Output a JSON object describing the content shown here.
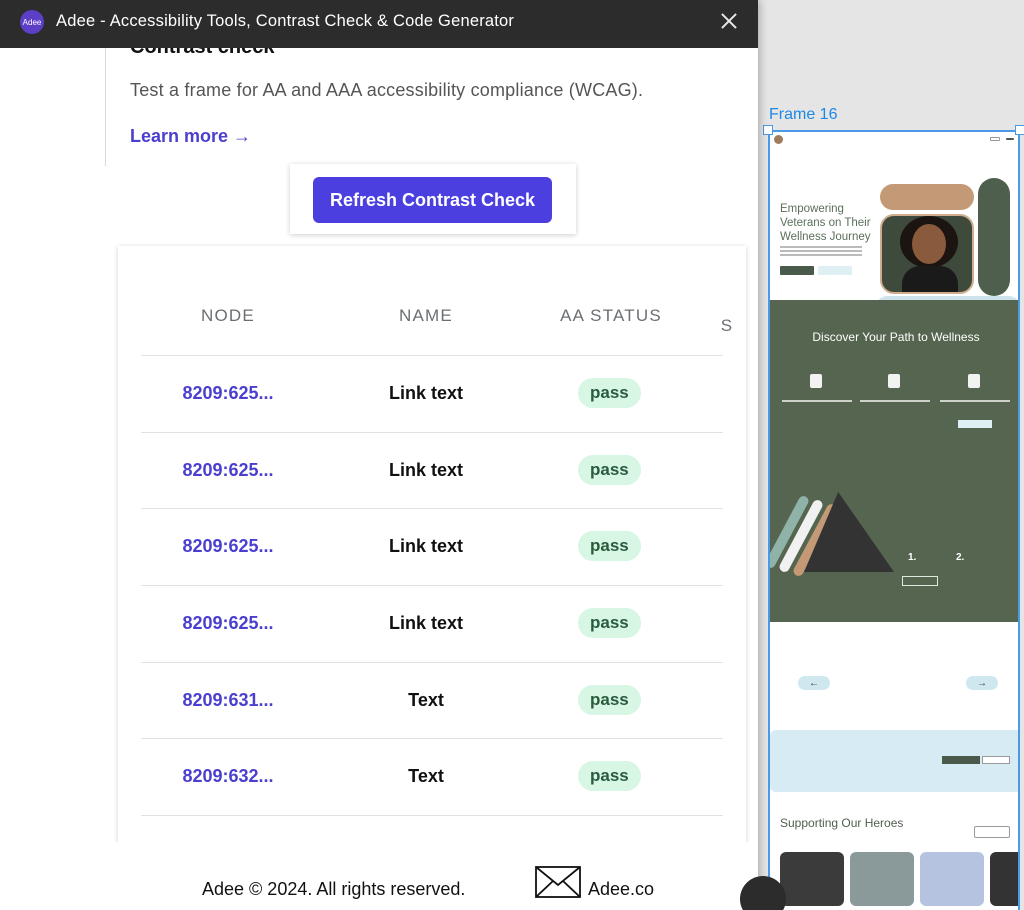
{
  "plugin": {
    "logo_text": "Adee",
    "title": "Adee - Accessibility Tools, Contrast Check & Code Generator"
  },
  "section": {
    "heading": "Contrast check",
    "description": "Test a frame for AA and AAA accessibility compliance (WCAG).",
    "learn_more": "Learn more →"
  },
  "refresh_button": "Refresh Contrast Check",
  "table": {
    "headers": [
      "NODE",
      "NAME",
      "AA STATUS",
      "S"
    ],
    "rows": [
      {
        "node": "8209:625...",
        "name": "Link text",
        "status": "pass"
      },
      {
        "node": "8209:625...",
        "name": "Link text",
        "status": "pass"
      },
      {
        "node": "8209:625...",
        "name": "Link text",
        "status": "pass"
      },
      {
        "node": "8209:625...",
        "name": "Link text",
        "status": "pass"
      },
      {
        "node": "8209:631...",
        "name": "Text",
        "status": "pass"
      },
      {
        "node": "8209:632...",
        "name": "Text",
        "status": "pass"
      }
    ]
  },
  "footer": {
    "copyright": "Adee © 2024. All rights reserved.",
    "link": "Adee.co"
  },
  "canvas": {
    "frame_label": "Frame 16",
    "hero_heading": "Empowering Veterans on Their Wellness Journey",
    "green_title": "Discover Your  Path to Wellness",
    "blog_title": "Supporting Our  Heroes"
  },
  "colors": {
    "accent": "#4b3fe0",
    "link": "#4a3fcf",
    "pass_bg": "#d7f6e4",
    "titlebar": "#2c2c2c",
    "selection": "#4a9ae8"
  }
}
